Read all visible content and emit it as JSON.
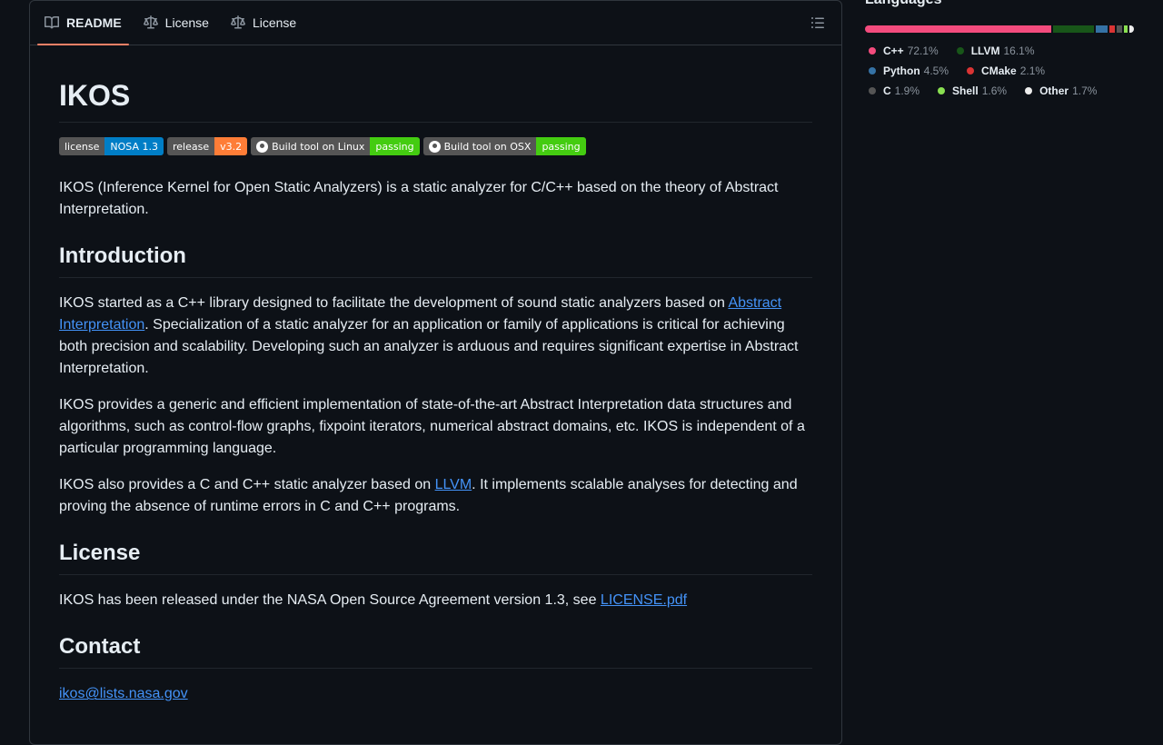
{
  "tabs": [
    {
      "label": "README",
      "icon": "book-icon"
    },
    {
      "label": "License",
      "icon": "law-icon"
    },
    {
      "label": "License",
      "icon": "law-icon"
    }
  ],
  "readme": {
    "title": "IKOS",
    "badges": [
      {
        "left": "license",
        "right": "NOSA 1.3",
        "color": "#007ec6"
      },
      {
        "left": "release",
        "right": "v3.2",
        "color": "#fe7d37"
      },
      {
        "left": "Build tool on Linux",
        "right": "passing",
        "color": "#4c1",
        "github": true
      },
      {
        "left": "Build tool on OSX",
        "right": "passing",
        "color": "#4c1",
        "github": true
      }
    ],
    "intro": "IKOS (Inference Kernel for Open Static Analyzers) is a static analyzer for C/C++ based on the theory of Abstract Interpretation.",
    "introduction_heading": "Introduction",
    "p1_a": "IKOS started as a C++ library designed to facilitate the development of sound static analyzers based on ",
    "p1_link": "Abstract Interpretation",
    "p1_b": ". Specialization of a static analyzer for an application or family of applications is critical for achieving both precision and scalability. Developing such an analyzer is arduous and requires significant expertise in Abstract Interpretation.",
    "p2": "IKOS provides a generic and efficient implementation of state-of-the-art Abstract Interpretation data structures and algorithms, such as control-flow graphs, fixpoint iterators, numerical abstract domains, etc. IKOS is independent of a particular programming language.",
    "p3_a": "IKOS also provides a C and C++ static analyzer based on ",
    "p3_link": "LLVM",
    "p3_b": ". It implements scalable analyses for detecting and proving the absence of runtime errors in C and C++ programs.",
    "license_heading": "License",
    "license_text": "IKOS has been released under the NASA Open Source Agreement version 1.3, see ",
    "license_link": "LICENSE.pdf",
    "contact_heading": "Contact",
    "contact_email": "ikos@lists.nasa.gov"
  },
  "languages": {
    "heading": "Languages",
    "items": [
      {
        "name": "C++",
        "percent": "72.1%",
        "value": 72.1,
        "color": "#f34b7d"
      },
      {
        "name": "LLVM",
        "percent": "16.1%",
        "value": 16.1,
        "color": "#185619"
      },
      {
        "name": "Python",
        "percent": "4.5%",
        "value": 4.5,
        "color": "#3572A5"
      },
      {
        "name": "CMake",
        "percent": "2.1%",
        "value": 2.1,
        "color": "#DA3434"
      },
      {
        "name": "C",
        "percent": "1.9%",
        "value": 1.9,
        "color": "#555555"
      },
      {
        "name": "Shell",
        "percent": "1.6%",
        "value": 1.6,
        "color": "#89e051"
      },
      {
        "name": "Other",
        "percent": "1.7%",
        "value": 1.7,
        "color": "#ededed"
      }
    ]
  }
}
